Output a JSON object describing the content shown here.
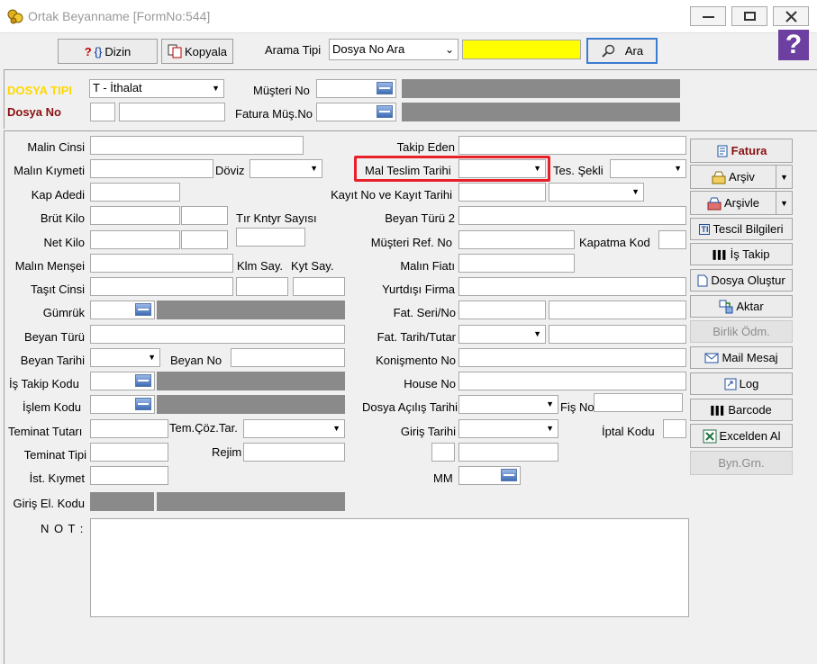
{
  "window": {
    "title": "Ortak Beyanname [FormNo:544]",
    "minimize_glyph": "—",
    "maximize_glyph": "▢",
    "close_glyph": "✕"
  },
  "toolbar": {
    "dizin_label": "Dizin",
    "kopyala_label": "Kopyala",
    "arama_tipi_label": "Arama Tipi",
    "arama_tipi_value": "Dosya No Ara",
    "search_value": "",
    "ara_label": "Ara",
    "help_glyph": "?"
  },
  "header": {
    "dosya_tipi_label": "DOSYA TIPI",
    "dosya_tipi_value": "T - İthalat",
    "dosya_no_label": "Dosya No",
    "musteri_no_label": "Müşteri No",
    "fatura_mus_no_label": "Fatura Müş.No"
  },
  "left": {
    "malin_cinsi": "Malin Cinsi",
    "malin_kiymeti": "Malın Kıymeti",
    "doviz": "Döviz",
    "kap_adedi": "Kap Adedi",
    "brut_kilo": "Brüt Kilo",
    "tir_kntyr": "Tır Kntyr Sayısı",
    "net_kilo": "Net Kilo",
    "malin_mensei": "Malın Menşei",
    "klm_say": "Klm Say.",
    "kyt_say": "Kyt Say.",
    "tasit_cinsi": "Taşıt Cinsi",
    "gumruk": "Gümrük",
    "beyan_turu": "Beyan Türü",
    "beyan_tarihi": "Beyan Tarihi",
    "beyan_no": "Beyan No",
    "is_takip_kodu": "İş Takip Kodu",
    "islem_kodu": "İşlem Kodu",
    "teminat_tutari": "Teminat Tutarı",
    "tem_coz_tar": "Tem.Çöz.Tar.",
    "teminat_tipi": "Teminat Tipi",
    "rejim": "Rejim",
    "ist_kiymet": "İst. Kıymet",
    "giris_el_kodu": "Giriş El. Kodu",
    "not": "N O T :"
  },
  "right": {
    "takip_eden": "Takip Eden",
    "mal_teslim_tarihi": "Mal Teslim Tarihi",
    "tes_sekli": "Tes. Şekli",
    "kayit_no": "Kayıt  No  ve Kayıt Tarihi",
    "beyan_turu_2": "Beyan Türü 2",
    "musteri_ref_no": "Müşteri  Ref. No",
    "kapatma_kod": "Kapatma Kod",
    "malin_fiati": "Malın Fiatı",
    "yurtdisi_firma": "Yurtdışı Firma",
    "fat_seri_no": "Fat. Seri/No",
    "fat_tarih_tutar": "Fat. Tarih/Tutar",
    "konismento_no": "Konişmento No",
    "house_no": "House No",
    "dosya_acilis_tarihi": "Dosya Açılış Tarihi",
    "fis_no": "Fiş No",
    "giris_tarihi": "Giriş Tarihi",
    "iptal_kodu": "İptal Kodu",
    "mm": "MM"
  },
  "sidebar": {
    "fatura": "Fatura",
    "arsiv": "Arşiv",
    "arsivle": "Arşivle",
    "tescil_bilgileri": "Tescil Bilgileri",
    "is_takip": "İş Takip",
    "dosya_olustur": "Dosya Oluştur",
    "aktar": "Aktar",
    "birlik_odm": "Birlik Ödm.",
    "mail_mesaj": "Mail Mesaj",
    "log": "Log",
    "barcode": "Barcode",
    "excelden_al": "Excelden Al",
    "byn_grn": "Byn.Grn."
  },
  "colors": {
    "dosya_tipi_label": "#ffd800",
    "dosya_no_label": "#8b1010",
    "search_bg": "#ffff00",
    "highlight": "#e8202a"
  }
}
